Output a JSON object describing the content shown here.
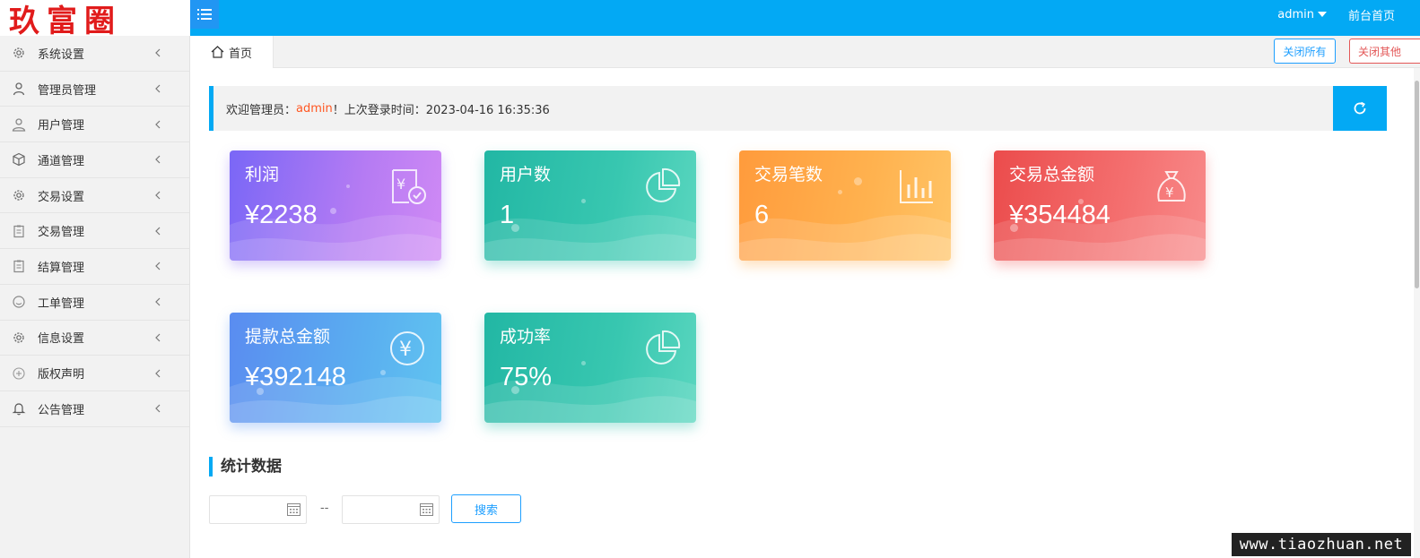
{
  "header": {
    "logo_text": "玖富圈",
    "user": "admin",
    "front_home": "前台首页"
  },
  "sidebar": {
    "items": [
      {
        "label": "系统设置",
        "icon": "gear-icon"
      },
      {
        "label": "管理员管理",
        "icon": "user-icon"
      },
      {
        "label": "用户管理",
        "icon": "users-icon"
      },
      {
        "label": "通道管理",
        "icon": "cube-icon"
      },
      {
        "label": "交易设置",
        "icon": "gear-icon"
      },
      {
        "label": "交易管理",
        "icon": "clipboard-icon"
      },
      {
        "label": "结算管理",
        "icon": "clipboard-icon"
      },
      {
        "label": "工单管理",
        "icon": "face-icon"
      },
      {
        "label": "信息设置",
        "icon": "gear-icon"
      },
      {
        "label": "版权声明",
        "icon": "plus-circle-icon"
      },
      {
        "label": "公告管理",
        "icon": "bell-icon"
      }
    ]
  },
  "tabs": {
    "home": "首页",
    "close_all": "关闭所有",
    "close_other": "关闭其他"
  },
  "welcome": {
    "prefix": "欢迎管理员：",
    "username": "admin",
    "suffix": "！上次登录时间：2023-04-16 16:35:36"
  },
  "cards": {
    "profit": {
      "title": "利润",
      "value": "¥2238"
    },
    "users": {
      "title": "用户数",
      "value": "1"
    },
    "tx_count": {
      "title": "交易笔数",
      "value": "6"
    },
    "tx_amount": {
      "title": "交易总金额",
      "value": "¥354484"
    },
    "withdraw": {
      "title": "提款总金额",
      "value": "¥392148"
    },
    "success_rate": {
      "title": "成功率",
      "value": "75%"
    }
  },
  "stats": {
    "title": "统计数据",
    "start_value": "",
    "end_value": "",
    "separator": "--",
    "search_label": "搜索"
  },
  "watermark": "www.tiaozhuan.net",
  "colors": {
    "primary": "#03a9f4",
    "accent_blue": "#1e9fff",
    "danger": "#e35757",
    "highlight": "#ff5722"
  }
}
